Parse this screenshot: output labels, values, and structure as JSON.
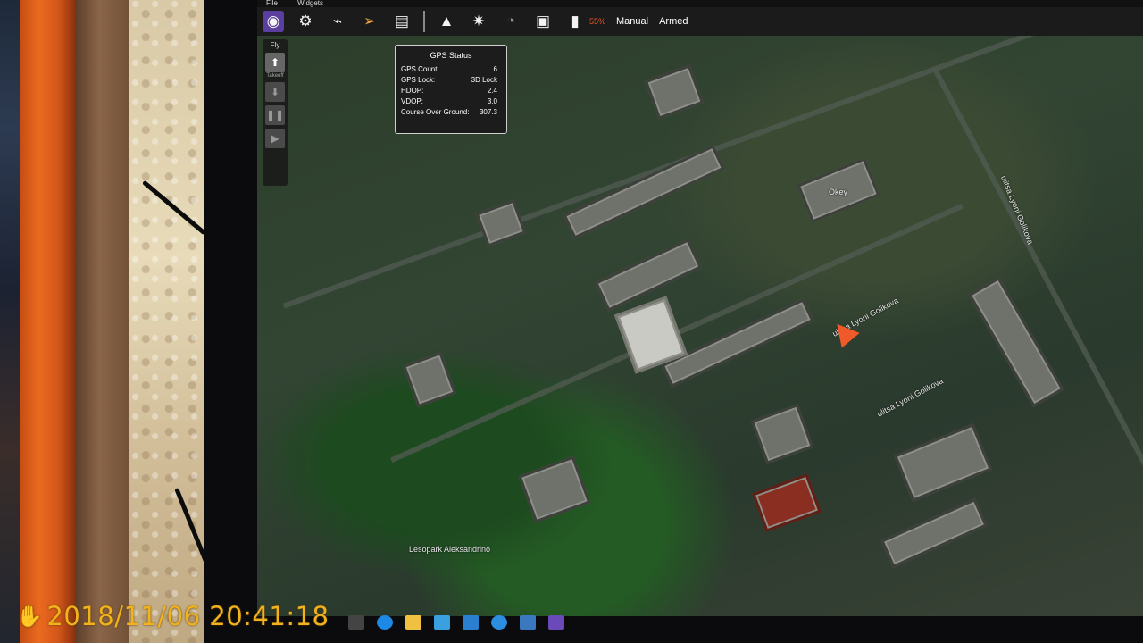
{
  "menu": {
    "file": "File",
    "widgets": "Widgets"
  },
  "toolbar": {
    "icons": [
      "qgc-logo-icon",
      "settings-gear-icon",
      "waypoint-plan-icon",
      "paper-plane-icon",
      "document-analyze-icon"
    ],
    "status_icons": [
      "warning-triangle-icon",
      "satellite-icon",
      "rc-signal-icon",
      "telemetry-icon",
      "battery-icon"
    ],
    "battery_percent": "55%",
    "flight_mode": "Manual",
    "arm_state": "Armed"
  },
  "fly_tools": {
    "title": "Fly",
    "buttons": [
      {
        "caption": "Takeoff",
        "icon": "arrow-up-icon"
      },
      {
        "caption": "Land",
        "icon": "arrow-down-icon"
      },
      {
        "caption": "Pause",
        "icon": "pause-icon"
      },
      {
        "caption": "Action",
        "icon": "play-icon"
      }
    ]
  },
  "gps_status": {
    "title": "GPS Status",
    "rows": [
      {
        "label": "GPS Count:",
        "value": "6"
      },
      {
        "label": "GPS Lock:",
        "value": "3D Lock"
      },
      {
        "label": "HDOP:",
        "value": "2.4"
      },
      {
        "label": "VDOP:",
        "value": "3.0"
      },
      {
        "label": "Course Over Ground:",
        "value": "307.3"
      }
    ]
  },
  "map": {
    "street_labels": [
      "ulitsa Lyoni Golikova",
      "ulitsa Lyoni Golikova",
      "ulitsa Lyoni Golikova",
      "Lesopark Aleksandrino",
      "Okey"
    ],
    "vehicle_color": "#f05a2a"
  },
  "taskbar": {
    "icons": [
      "task-view-icon",
      "edge-icon",
      "file-explorer-icon",
      "store-icon",
      "mail-icon",
      "ie-icon",
      "qgc-app-icon",
      "qgc-taskbar-icon"
    ]
  },
  "camera": {
    "timestamp": "2018/11/06 20:41:18",
    "color": "#f2b21d"
  }
}
